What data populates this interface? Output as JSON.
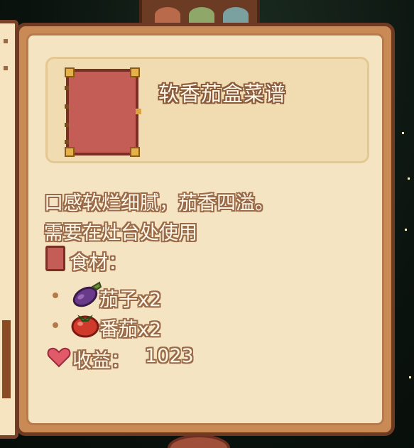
{
  "tooltip": {
    "title": "软香茄盒菜谱",
    "description_line1": "口感软烂细腻，茄香四溢。",
    "description_line2": "需要在灶台处使用",
    "ingredients_label": "食材：",
    "ingredients": [
      {
        "name": "茄子x2",
        "icon": "eggplant-icon"
      },
      {
        "name": "番茄x2",
        "icon": "tomato-icon"
      }
    ],
    "profit_label": "收益：",
    "profit_value": "1023"
  },
  "colors": {
    "panel_border": "#6e3a22",
    "panel_fill": "#f5e4c2",
    "recipe_book": "#c45d55",
    "text": "#fff7e8",
    "text_outline": "#9a6a48"
  }
}
